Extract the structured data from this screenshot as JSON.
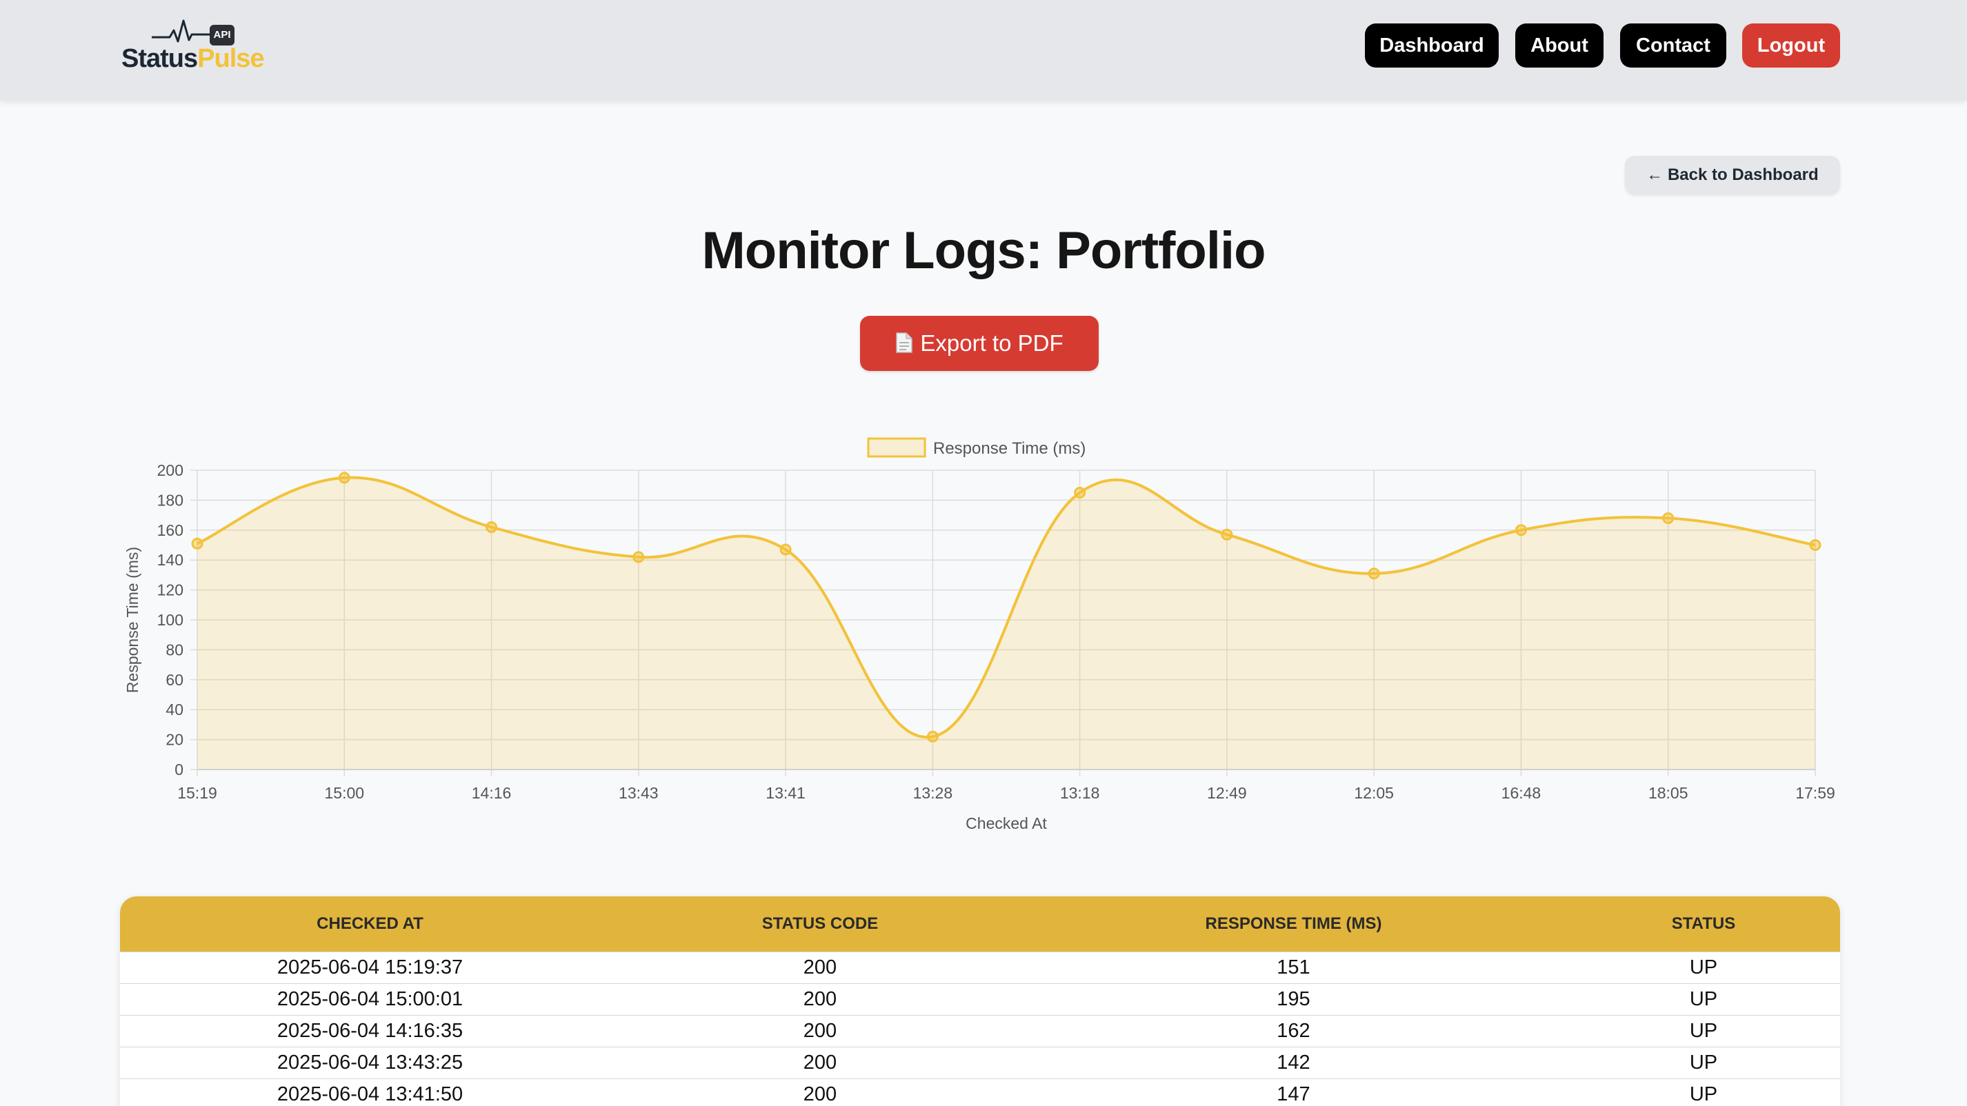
{
  "brand": {
    "name_part1": "Status",
    "name_part2": "Pulse",
    "badge": "API"
  },
  "nav": {
    "dashboard": "Dashboard",
    "about": "About",
    "contact": "Contact",
    "logout": "Logout"
  },
  "back_label": "← Back to Dashboard",
  "page_title": "Monitor Logs: Portfolio",
  "export_label": "Export to PDF",
  "colors": {
    "accent": "#f3c239",
    "danger": "#d63b32",
    "table_header": "#e1b43c",
    "nav_button": "#000000"
  },
  "chart_data": {
    "type": "line",
    "categories": [
      "15:19",
      "15:00",
      "14:16",
      "13:43",
      "13:41",
      "13:28",
      "13:18",
      "12:49",
      "12:05",
      "16:48",
      "18:05",
      "17:59"
    ],
    "series": [
      {
        "name": "Response Time (ms)",
        "values": [
          151,
          195,
          162,
          142,
          147,
          22,
          185,
          157,
          131,
          160,
          168,
          150
        ]
      }
    ],
    "xlabel": "Checked At",
    "ylabel": "Response Time (ms)",
    "ylim": [
      0,
      200
    ],
    "yticks": [
      0,
      20,
      40,
      60,
      80,
      100,
      120,
      140,
      160,
      180,
      200
    ],
    "grid": true,
    "legend": "top-center",
    "fill": true,
    "smooth": true
  },
  "table": {
    "headers": [
      "Checked At",
      "Status Code",
      "Response Time (ms)",
      "Status"
    ],
    "rows": [
      [
        "2025-06-04 15:19:37",
        "200",
        "151",
        "UP"
      ],
      [
        "2025-06-04 15:00:01",
        "200",
        "195",
        "UP"
      ],
      [
        "2025-06-04 14:16:35",
        "200",
        "162",
        "UP"
      ],
      [
        "2025-06-04 13:43:25",
        "200",
        "142",
        "UP"
      ],
      [
        "2025-06-04 13:41:50",
        "200",
        "147",
        "UP"
      ]
    ]
  }
}
